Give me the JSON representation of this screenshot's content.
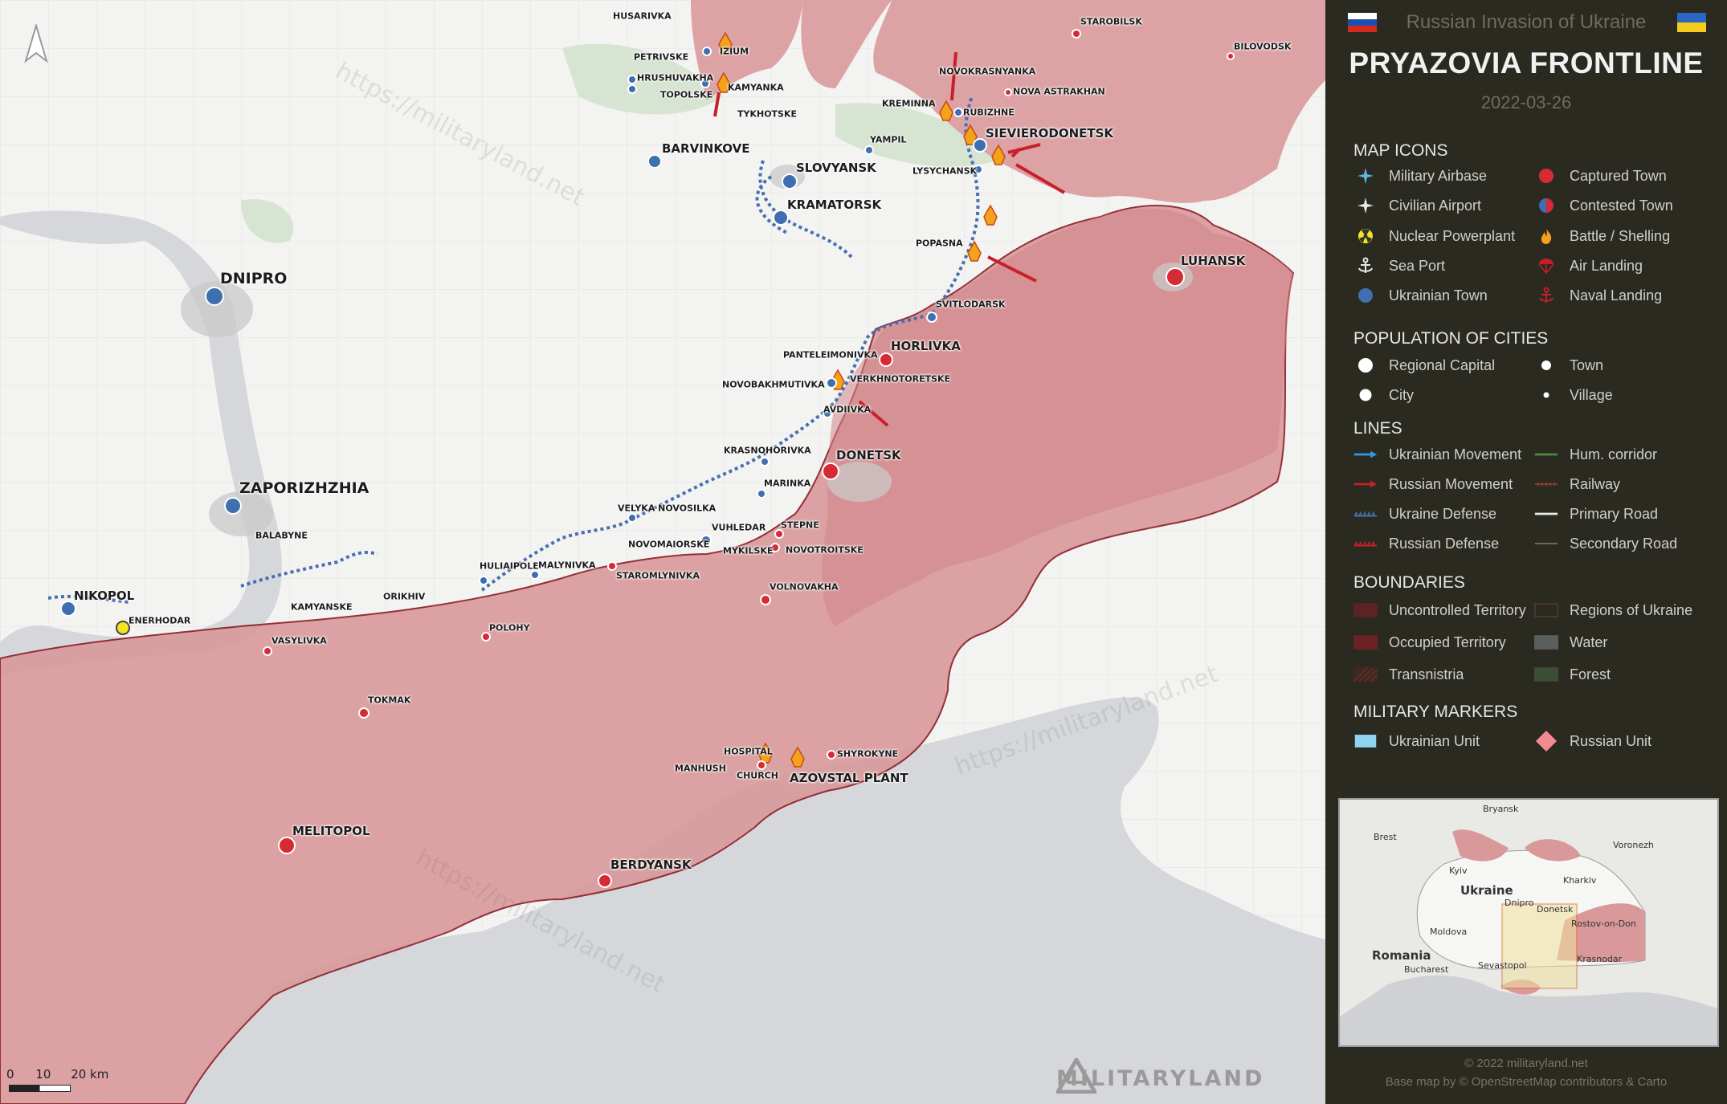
{
  "header": {
    "subtitle": "Russian Invasion of Ukraine",
    "title": "PRYAZOVIA FRONTLINE",
    "date": "2022-03-26"
  },
  "colors": {
    "occupied": "#d9999b",
    "occupied_border": "#8a1c25",
    "water": "#d6d7da",
    "panel_bg": "#2b2a20",
    "ukraine_town": "#3f6fb0",
    "captured_town": "#d62a34",
    "forest": "#c9dcc4"
  },
  "legend": {
    "map_icons_title": "MAP ICONS",
    "map_icons": [
      {
        "icon": "military-airbase-icon",
        "label": "Military Airbase"
      },
      {
        "icon": "captured-town-icon",
        "label": "Captured Town"
      },
      {
        "icon": "civilian-airport-icon",
        "label": "Civilian Airport"
      },
      {
        "icon": "contested-town-icon",
        "label": "Contested Town"
      },
      {
        "icon": "nuclear-powerplant-icon",
        "label": "Nuclear Powerplant"
      },
      {
        "icon": "battle-shelling-icon",
        "label": "Battle / Shelling"
      },
      {
        "icon": "sea-port-icon",
        "label": "Sea Port"
      },
      {
        "icon": "air-landing-icon",
        "label": "Air Landing"
      },
      {
        "icon": "ukrainian-town-icon",
        "label": "Ukrainian Town"
      },
      {
        "icon": "naval-landing-icon",
        "label": "Naval Landing"
      }
    ],
    "population_title": "POPULATION OF CITIES",
    "population": [
      {
        "icon": "regional-capital-icon",
        "label": "Regional Capital"
      },
      {
        "icon": "town-icon",
        "label": "Town"
      },
      {
        "icon": "city-icon",
        "label": "City"
      },
      {
        "icon": "village-icon",
        "label": "Village"
      }
    ],
    "lines_title": "LINES",
    "lines": [
      {
        "icon": "ukrainian-movement-icon",
        "label": "Ukrainian Movement"
      },
      {
        "icon": "hum-corridor-icon",
        "label": "Hum. corridor"
      },
      {
        "icon": "russian-movement-icon",
        "label": "Russian Movement"
      },
      {
        "icon": "railway-icon",
        "label": "Railway"
      },
      {
        "icon": "ukraine-defense-icon",
        "label": "Ukraine Defense"
      },
      {
        "icon": "primary-road-icon",
        "label": "Primary Road"
      },
      {
        "icon": "russian-defense-icon",
        "label": "Russian Defense"
      },
      {
        "icon": "secondary-road-icon",
        "label": "Secondary Road"
      }
    ],
    "boundaries_title": "BOUNDARIES",
    "boundaries": [
      {
        "icon": "uncontrolled-territory-icon",
        "label": "Uncontrolled Territory"
      },
      {
        "icon": "regions-of-ukraine-icon",
        "label": "Regions of Ukraine"
      },
      {
        "icon": "occupied-territory-icon",
        "label": "Occupied Territory"
      },
      {
        "icon": "water-icon",
        "label": "Water"
      },
      {
        "icon": "transnistria-icon",
        "label": "Transnistria"
      },
      {
        "icon": "forest-icon",
        "label": "Forest"
      }
    ],
    "markers_title": "MILITARY MARKERS",
    "markers": [
      {
        "icon": "ukrainian-unit-icon",
        "label": "Ukrainian Unit"
      },
      {
        "icon": "russian-unit-icon",
        "label": "Russian Unit"
      }
    ]
  },
  "map_labels": {
    "dnipro": "DNIPRO",
    "zaporizhzhia": "ZAPORIZHZHIA",
    "nikopol": "NIKOPOL",
    "enerhodar": "ENERHODAR",
    "balabyne": "BALABYNE",
    "kamyanske": "KAMYANSKE",
    "vasylivka": "VASYLIVKA",
    "orikhiv": "ORIKHIV",
    "polohy": "POLOHY",
    "tokmak": "TOKMAK",
    "melitopol": "MELITOPOL",
    "berdyansk": "BERDYANSK",
    "hulaipole": "HULIAIPOLE",
    "malynivka": "MALYNIVKA",
    "staromlynivka": "STAROMLYNIVKA",
    "velyka_novosilka": "VELYKA NOVOSILKA",
    "novomaiorske": "NOVOMAIORSKE",
    "vuhledar": "VUHLEDAR",
    "mykilske": "MYKILSKE",
    "stepne": "STEPNE",
    "novotroitske": "NOVOTROITSKE",
    "volnovakha": "VOLNOVAKHA",
    "marinka": "MARINKA",
    "krasnohorivka": "KRASNOHORIVKA",
    "donetsk": "DONETSK",
    "avdiivka": "AVDIIVKA",
    "novobakhmutivka": "NOVOBAKHMUTIVKA",
    "verkhnotoretske": "VERKHNOTORETSKE",
    "panteleimonivka": "PANTELEIMONIVKA",
    "horlivka": "HORLIVKA",
    "svitlodarsk": "SVITLODARSK",
    "popasna": "POPASNA",
    "luhansk": "LUHANSK",
    "lysychansk": "LYSYCHANSK",
    "sievierodonetsk": "SIEVIERODONETSK",
    "rubizhne": "RUBIZHNE",
    "kreminna": "KREMINNA",
    "novokrasnyanka": "NOVOKRASNYANKA",
    "nova_astrakhan": "NOVA ASTRAKHAN",
    "starobilsk": "STAROBILSK",
    "bilovodsk": "BILOVODSK",
    "yampil": "YAMPIL",
    "kramatorsk": "KRAMATORSK",
    "slovyansk": "SLOVYANSK",
    "barvinkove": "BARVINKOVE",
    "izium": "IZIUM",
    "kamyanka": "KAMYANKA",
    "tykhotske": "TYKHOTSKE",
    "topolske": "TOPOLSKE",
    "hrushuvakha": "HRUSHUVAKHA",
    "petrivske": "PETRIVSKE",
    "husarivka": "HUSARIVKA",
    "hospital": "HOSPITAL",
    "church": "CHURCH",
    "manhush": "MANHUSH",
    "azovstal": "AZOVSTAL PLANT",
    "shyrokyne": "SHYROKYNE"
  },
  "scale": {
    "zero": "0",
    "ten": "10",
    "twenty": "20 km"
  },
  "brand": "MILITARYLAND",
  "watermark": "https://militaryland.net",
  "inset": {
    "bryansk": "Bryansk",
    "brest": "Brest",
    "voronezh": "Voronezh",
    "kyiv": "Kyiv",
    "kharkiv": "Kharkiv",
    "ukraine": "Ukraine",
    "dnipro": "Dnipro",
    "donetsk": "Donetsk",
    "rostov": "Rostov-on-Don",
    "moldova": "Moldova",
    "romania": "Romania",
    "bucharest": "Bucharest",
    "krasnodar": "Krasnodar",
    "sevastopol": "Sevastopol"
  },
  "footer": {
    "copyright": "© 2022 militaryland.net",
    "basemap": "Base map by © OpenStreetMap contributors & Carto"
  }
}
